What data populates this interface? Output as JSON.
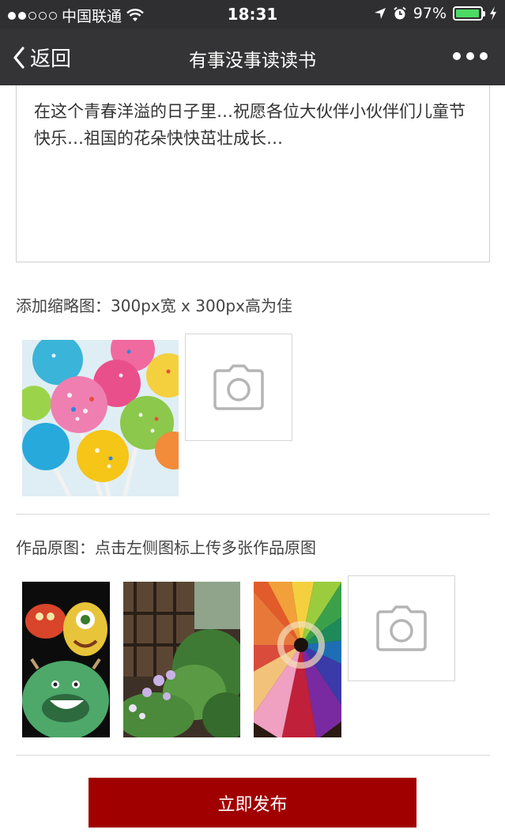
{
  "status_bar": {
    "carrier": "中国联通",
    "time": "18:31",
    "battery": "97%",
    "battery_level": 0.97
  },
  "nav": {
    "back_label": "返回",
    "title": "有事没事读读书"
  },
  "content": {
    "text": "在这个青春洋溢的日子里…祝愿各位大伙伴小伙伴们儿童节快乐…祖国的花朵快快茁壮成长…"
  },
  "thumbnail_section": {
    "label": "添加缩略图：300px宽 x 300px高为佳"
  },
  "original_section": {
    "label": "作品原图：点击左侧图标上传多张作品原图"
  },
  "submit": {
    "label": "立即发布"
  },
  "colors": {
    "accent": "#a10000",
    "navbar": "#343436",
    "statusbar": "#2f2f31",
    "battery": "#4cd964"
  }
}
